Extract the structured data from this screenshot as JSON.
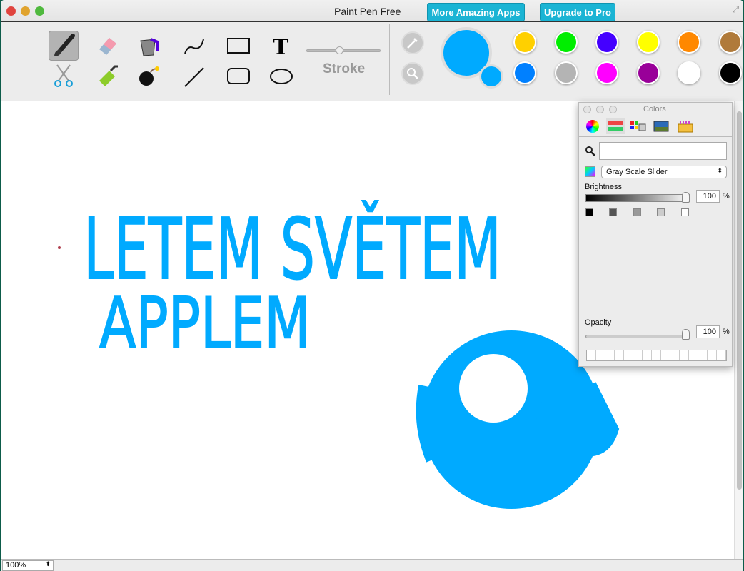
{
  "window": {
    "title": "Paint Pen Free",
    "more_apps": "More Amazing Apps",
    "upgrade": "Upgrade to Pro"
  },
  "toolbar": {
    "stroke_label": "Stroke",
    "stroke_value": 0.45,
    "tools": [
      "brush",
      "eraser",
      "paint-bucket",
      "curve",
      "rectangle",
      "text",
      "scissors",
      "marker",
      "bomb",
      "line",
      "rounded-rectangle",
      "ellipse"
    ],
    "selected_tool": "brush"
  },
  "colors": {
    "current": "#00aaff",
    "secondary": "#00aaff",
    "palette": [
      "#ffd000",
      "#00ee00",
      "#4400ff",
      "#ffff00",
      "#ff8800",
      "#b07a3a",
      "#0080ff",
      "#b4b4b4",
      "#ff00ff",
      "#990099",
      "#ffffff",
      "#000000"
    ]
  },
  "colors_panel": {
    "title": "Colors",
    "mode": "Gray Scale Slider",
    "brightness_label": "Brightness",
    "brightness": "100",
    "opacity_label": "Opacity",
    "opacity": "100",
    "percent": "%",
    "search_value": ""
  },
  "canvas": {
    "ink": "#00aaff",
    "text_lines": [
      "LETEM SVĚTEM",
      "APPLEM"
    ]
  },
  "status": {
    "zoom": "100%"
  }
}
